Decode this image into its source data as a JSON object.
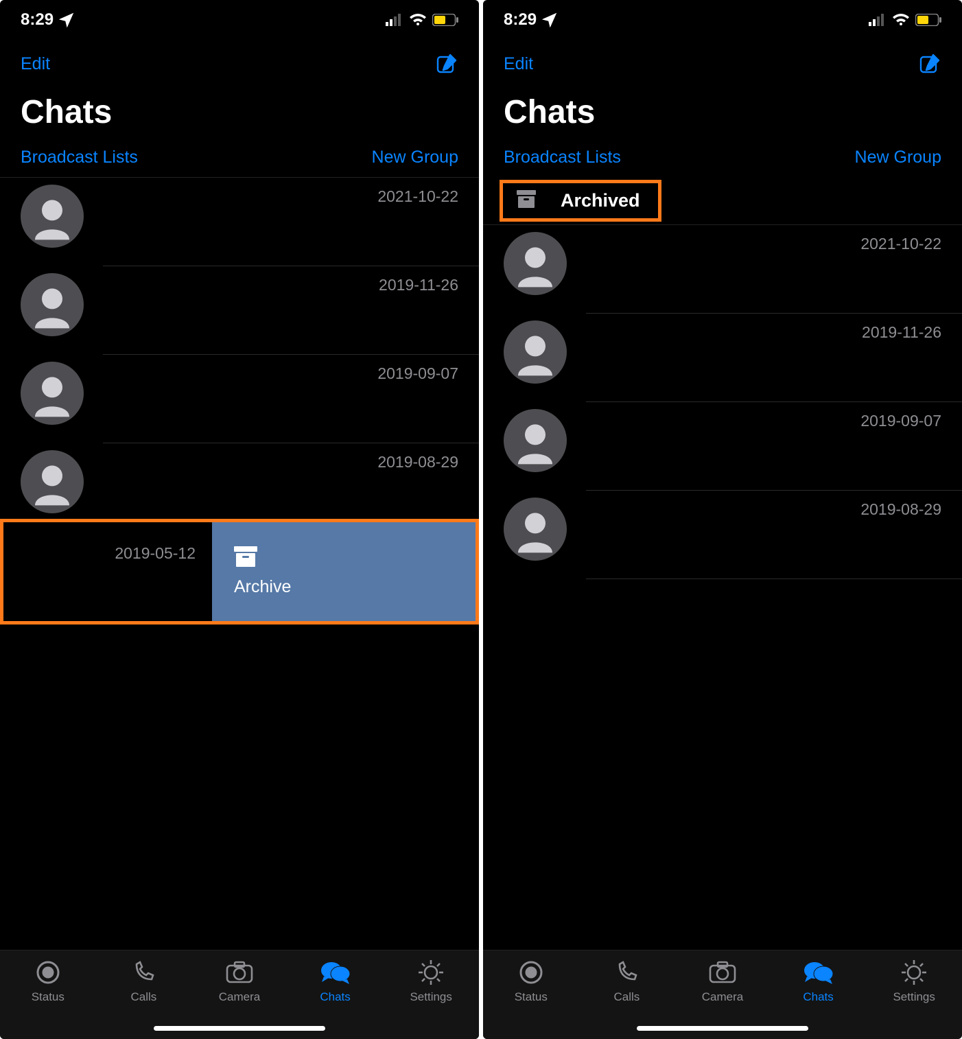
{
  "status": {
    "time": "8:29"
  },
  "nav": {
    "edit": "Edit"
  },
  "title": "Chats",
  "links": {
    "broadcast": "Broadcast Lists",
    "newgroup": "New Group"
  },
  "left": {
    "chats": [
      {
        "date": "2021-10-22"
      },
      {
        "date": "2019-11-26"
      },
      {
        "date": "2019-09-07"
      },
      {
        "date": "2019-08-29"
      }
    ],
    "swipe": {
      "date": "2019-05-12",
      "action": "Archive"
    }
  },
  "right": {
    "archived_label": "Archived",
    "chats": [
      {
        "date": "2021-10-22"
      },
      {
        "date": "2019-11-26"
      },
      {
        "date": "2019-09-07"
      },
      {
        "date": "2019-08-29"
      }
    ]
  },
  "tabs": {
    "status": "Status",
    "calls": "Calls",
    "camera": "Camera",
    "chats": "Chats",
    "settings": "Settings"
  }
}
